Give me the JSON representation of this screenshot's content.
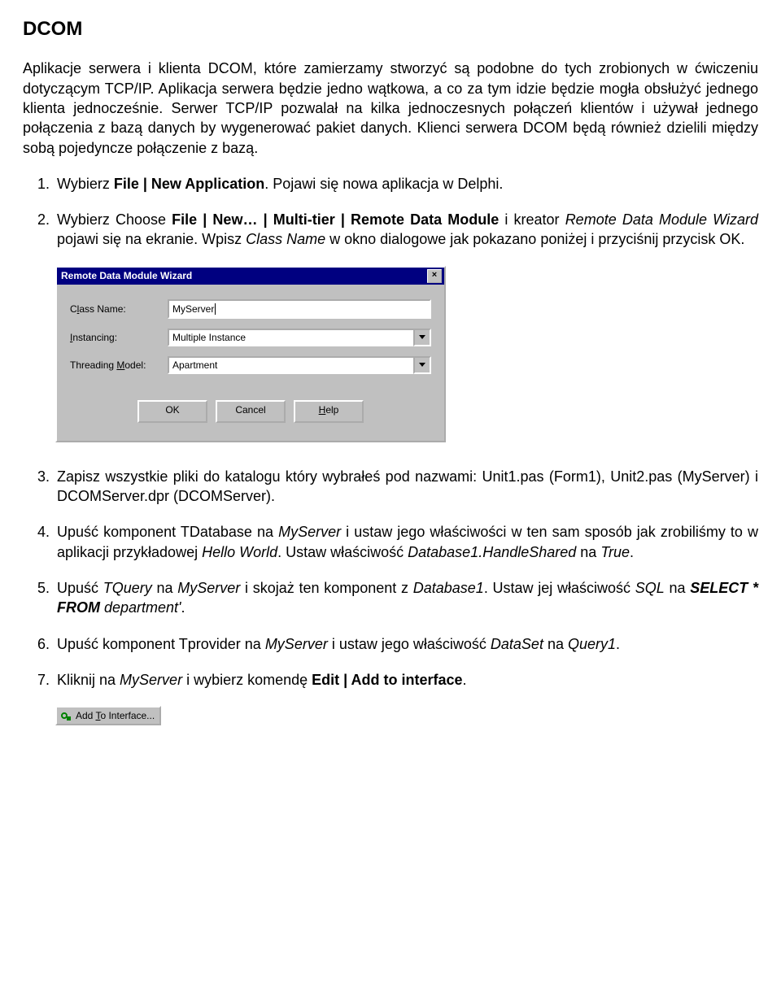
{
  "heading": "DCOM",
  "intro": "Aplikacje serwera i klienta DCOM, które zamierzamy stworzyć są podobne do tych zrobionych w ćwiczeniu dotyczącym TCP/IP. Aplikacja serwera będzie jedno wątkowa, a co za tym idzie będzie mogła obsłużyć jednego klienta jednocześnie. Serwer TCP/IP pozwalał na kilka jednoczesnych połączeń klientów i używał jednego połączenia z bazą danych by wygenerować pakiet danych. Klienci serwera DCOM będą również dzielili między sobą pojedyncze połączenie z bazą.",
  "step1_pre": "Wybierz ",
  "step1_bold": "File | New Application",
  "step1_post": ". Pojawi się nowa aplikacja w Delphi.",
  "step2_a": "Wybierz Choose ",
  "step2_b": "File | New… | Multi-tier | Remote Data Module",
  "step2_c": " i kreator ",
  "step2_d": "Remote Data Module Wizard",
  "step2_e": " pojawi się na ekranie. Wpisz ",
  "step2_f": "Class Name",
  "step2_g": " w okno dialogowe jak pokazano poniżej i przyciśnij przycisk OK.",
  "dialog": {
    "title": "Remote Data Module Wizard",
    "classname_label_pre": "C",
    "classname_label_ul": "l",
    "classname_label_post": "ass Name:",
    "classname_value": "MyServer",
    "instancing_label_ul": "I",
    "instancing_label_post": "nstancing:",
    "instancing_value": "Multiple Instance",
    "threading_label_pre": "Threading ",
    "threading_label_ul": "M",
    "threading_label_post": "odel:",
    "threading_value": "Apartment",
    "ok": "OK",
    "cancel": "Cancel",
    "help_ul": "H",
    "help_post": "elp"
  },
  "step3": "Zapisz wszystkie pliki do katalogu który wybrałeś pod nazwami: Unit1.pas (Form1), Unit2.pas (MyServer) i DCOMServer.dpr (DCOMServer).",
  "step4_a": "Upuść komponent TDatabase na ",
  "step4_b": "MyServer",
  "step4_c": " i ustaw jego właściwości w ten sam sposób jak zrobiliśmy to w aplikacji przykładowej ",
  "step4_d": "Hello World",
  "step4_e": ". Ustaw właściwość ",
  "step4_f": "Database1.HandleShared",
  "step4_g": " na ",
  "step4_h": "True",
  "step4_i": ".",
  "step5_a": "Upuść ",
  "step5_b": "TQuery",
  "step5_c": " na ",
  "step5_d": "MyServer",
  "step5_e": " i skojaż ten komponent z ",
  "step5_f": "Database1",
  "step5_g": ". Ustaw jej właściwość ",
  "step5_h": "SQL",
  "step5_i": " na ",
  "step5_j": "SELECT * FROM",
  "step5_k": " department'",
  "step5_l": ".",
  "step6_a": "Upuść komponent Tprovider na ",
  "step6_b": "MyServer",
  "step6_c": " i ustaw jego właściwość ",
  "step6_d": "DataSet",
  "step6_e": " na ",
  "step6_f": "Query1",
  "step6_g": ".",
  "step7_a": "Kliknij na ",
  "step7_b": "MyServer",
  "step7_c": " i wybierz komendę ",
  "step7_d": "Edit | Add to interface",
  "step7_e": ".",
  "addbtn_pre": "Add ",
  "addbtn_ul": "T",
  "addbtn_post": "o Interface..."
}
